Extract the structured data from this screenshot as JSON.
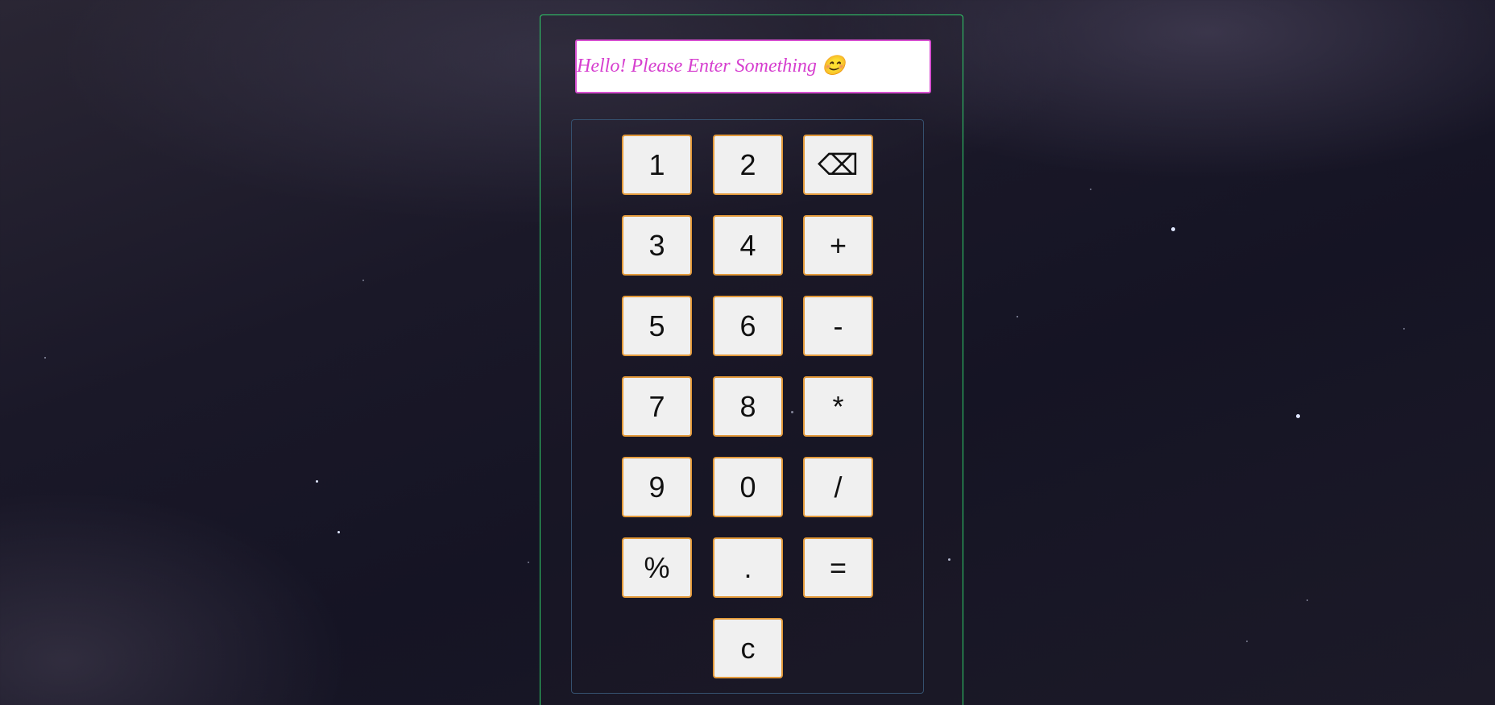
{
  "display": {
    "placeholder": "Hello! Please Enter Something 😊"
  },
  "keys": {
    "one": "1",
    "two": "2",
    "backspace": "⌫",
    "three": "3",
    "four": "4",
    "plus": "+",
    "five": "5",
    "six": "6",
    "minus": "-",
    "seven": "7",
    "eight": "8",
    "multiply": "*",
    "nine": "9",
    "zero": "0",
    "divide": "/",
    "percent": "%",
    "decimal": ".",
    "equals": "=",
    "clear": "c"
  },
  "colors": {
    "frame_border": "#2fd06a",
    "display_border": "#d64fd0",
    "display_text": "#d63fcf",
    "key_border": "#e39a3b",
    "key_background": "#f0f0f0"
  }
}
